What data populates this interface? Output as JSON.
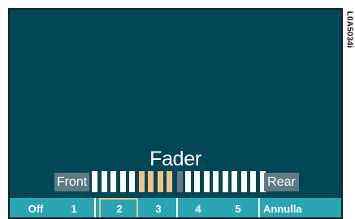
{
  "side_code": "L0A5034i",
  "title": "Fader",
  "labels": {
    "front": "Front",
    "rear": "Rear"
  },
  "fader": {
    "segments": 18,
    "active_segments": [
      5,
      6,
      7,
      8
    ]
  },
  "menu": {
    "items": [
      "Off",
      "1",
      "2",
      "3",
      "4",
      "5",
      "Annulla"
    ],
    "selected": "2"
  },
  "colors": {
    "screen_bg": "#034656",
    "menu_bg": "#2aa5b3",
    "label_bg": "#5f7a85",
    "active": "#f2c088",
    "bar": "#ffffff"
  }
}
